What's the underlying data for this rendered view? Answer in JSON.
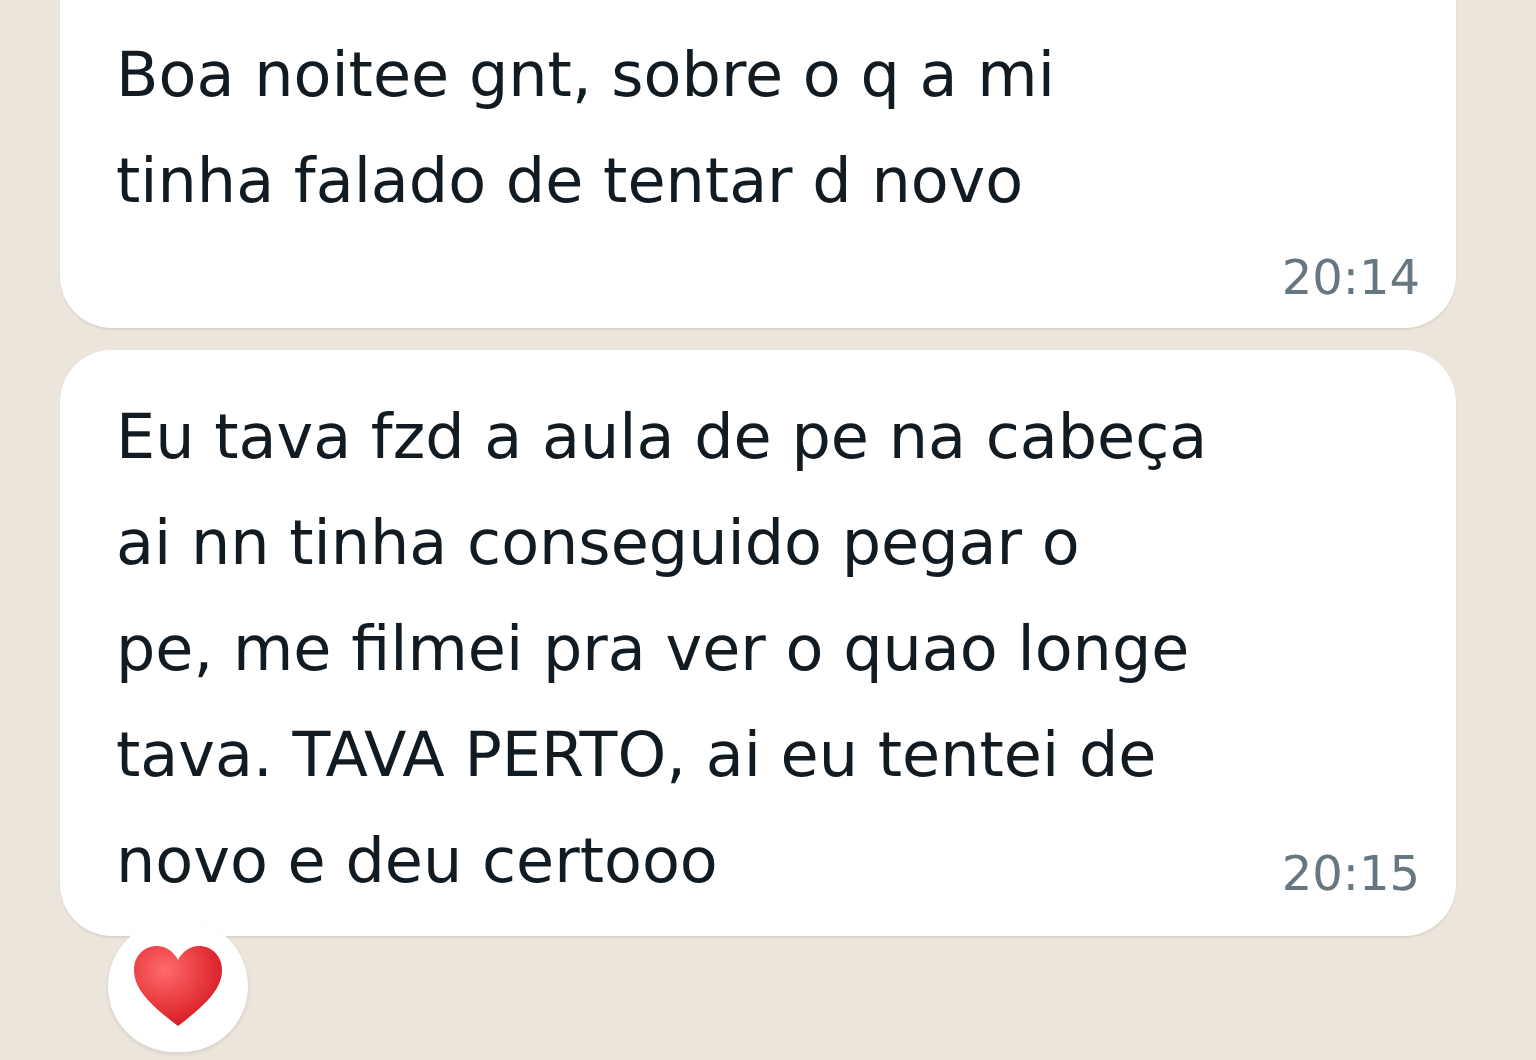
{
  "messages": [
    {
      "text": "Boa noitee gnt, sobre o q a mi\ntinha falado de tentar d novo",
      "time": "20:14",
      "kind": "time-below",
      "reacted": false
    },
    {
      "text": "Eu tava fzd a aula de pe na cabeça\nai nn tinha conseguido pegar o\npe, me filmei pra ver o quao longe\ntava. TAVA PERTO, ai eu tentei de\nnovo e deu certooo",
      "time": "20:15",
      "kind": "time-inline",
      "reacted": true
    }
  ]
}
